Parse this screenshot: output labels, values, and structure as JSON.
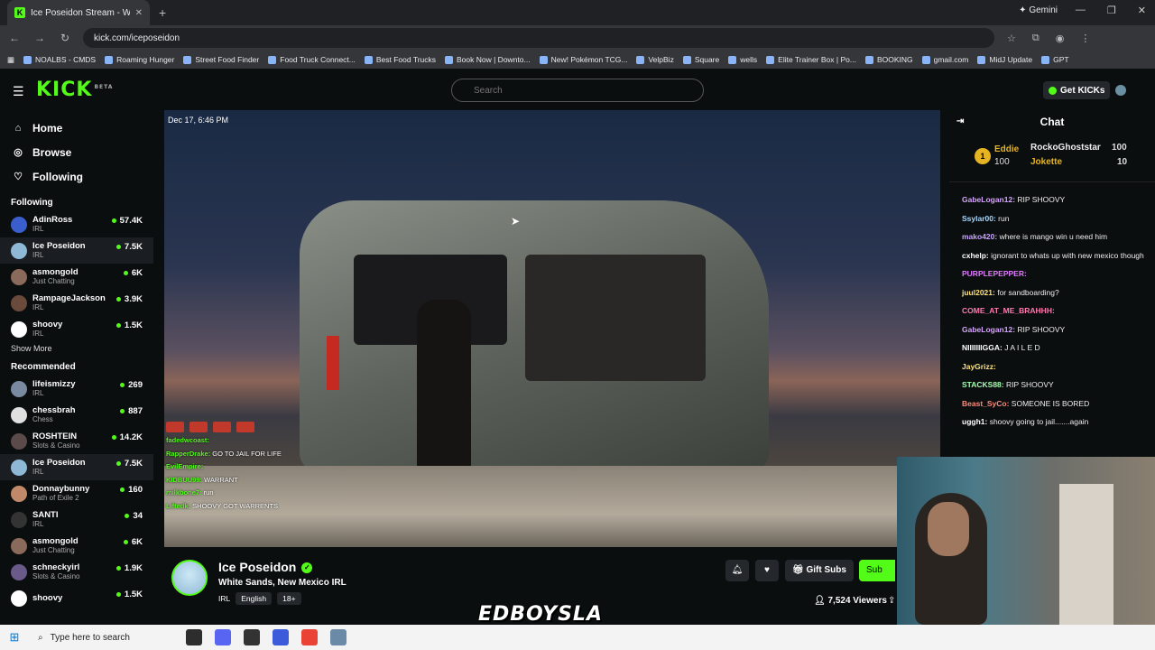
{
  "browser": {
    "tab_title": "Ice Poseidon Stream - Wat",
    "tab_favicon": "K",
    "gemini_label": "Gemini",
    "url": "kick.com/iceposeidon",
    "bookmarks": [
      "NOALBS - CMDS",
      "Roaming Hunger",
      "Street Food Finder",
      "Food Truck Connect...",
      "Best Food Trucks",
      "Book Now | Downto...",
      "New! Pokémon TCG...",
      "VelpBiz",
      "Square",
      "wells",
      "Elite Trainer Box | Po...",
      "BOOKING",
      "gmail.com",
      "MidJ Update",
      "GPT"
    ]
  },
  "header": {
    "logo": "KICK",
    "logo_badge": "BETA",
    "search_placeholder": "Search",
    "get_kicks": "Get KICKs"
  },
  "sidebar": {
    "nav": [
      {
        "label": "Home",
        "icon": "home-icon"
      },
      {
        "label": "Browse",
        "icon": "compass-icon"
      },
      {
        "label": "Following",
        "icon": "heart-icon"
      }
    ],
    "following_title": "Following",
    "following": [
      {
        "name": "AdinRoss",
        "category": "IRL",
        "viewers": "57.4K",
        "color": "#3a5fcd"
      },
      {
        "name": "Ice Poseidon",
        "category": "IRL",
        "viewers": "7.5K",
        "color": "#8fb8d6"
      },
      {
        "name": "asmongold",
        "category": "Just Chatting",
        "viewers": "6K",
        "color": "#8a6a5a"
      },
      {
        "name": "RampageJackson",
        "category": "IRL",
        "viewers": "3.9K",
        "color": "#6a4a3a"
      },
      {
        "name": "shoovy",
        "category": "IRL",
        "viewers": "1.5K",
        "color": "#ffffff"
      }
    ],
    "show_more": "Show More",
    "recommended_title": "Recommended",
    "recommended": [
      {
        "name": "lifeismizzy",
        "category": "IRL",
        "viewers": "269",
        "color": "#7a8aa0"
      },
      {
        "name": "chessbrah",
        "category": "Chess",
        "viewers": "887",
        "color": "#e0e0e0"
      },
      {
        "name": "ROSHTEIN",
        "category": "Slots & Casino",
        "viewers": "14.2K",
        "color": "#5a4a4a"
      },
      {
        "name": "Ice Poseidon",
        "category": "IRL",
        "viewers": "7.5K",
        "color": "#8fb8d6"
      },
      {
        "name": "Donnaybunny",
        "category": "Path of Exile 2",
        "viewers": "160",
        "color": "#c08a6a"
      },
      {
        "name": "SANTI",
        "category": "IRL",
        "viewers": "34",
        "color": "#333333"
      },
      {
        "name": "asmongold",
        "category": "Just Chatting",
        "viewers": "6K",
        "color": "#8a6a5a"
      },
      {
        "name": "schneckyirl",
        "category": "Slots & Casino",
        "viewers": "1.9K",
        "color": "#6a5a8a"
      },
      {
        "name": "shoovy",
        "category": "",
        "viewers": "1.5K",
        "color": "#ffffff"
      }
    ]
  },
  "video": {
    "timestamp": "Dec 17, 6:46 PM",
    "overlay_chat": [
      {
        "user": "fadedwcoast:",
        "text": ""
      },
      {
        "user": "RapperDrake:",
        "text": "GO TO JAIL FOR LIFE"
      },
      {
        "user": "EvilEmpire:",
        "text": ""
      },
      {
        "user": "KIDBUU99:",
        "text": "WARRANT"
      },
      {
        "user": "milkbone7:",
        "text": "run"
      },
      {
        "user": "Liftedk:",
        "text": "SHOOVY GOT WARRENTS"
      }
    ]
  },
  "stream": {
    "channel": "Ice Poseidon",
    "title": "White Sands, New Mexico IRL",
    "category": "IRL",
    "language": "English",
    "age": "18+",
    "gift_subs": "Gift Subs",
    "subscribe": "Sub",
    "viewers": "7,524 Viewers"
  },
  "watermark": "EDBOYSLA",
  "chat": {
    "title": "Chat",
    "pinned": {
      "rank": "1",
      "first_user": "Eddie",
      "first_amount": "100",
      "second_user": "RockoGhoststar",
      "second_amount": "100",
      "third_user": "Jokette",
      "third_amount": "10"
    },
    "messages": [
      {
        "user": "GabeLogan12:",
        "text": "RIP SHOOVY",
        "color": "#d7a5ff"
      },
      {
        "user": "Ssylar00:",
        "text": "run",
        "color": "#a5d8ff"
      },
      {
        "user": "mako420:",
        "text": "where is mango win u need him",
        "color": "#c8a5ff"
      },
      {
        "user": "cxhelp:",
        "text": "ignorant to whats up with new mexico though",
        "color": "#ffffff"
      },
      {
        "user": "PURPLEPEPPER:",
        "text": "",
        "color": "#e07aff"
      },
      {
        "user": "juul2021:",
        "text": "for sandboarding?",
        "color": "#ffe37a"
      },
      {
        "user": "COME_AT_ME_BRAHHH:",
        "text": "",
        "color": "#ff7ab0"
      },
      {
        "user": "GabeLogan12:",
        "text": "RIP SHOOVY",
        "color": "#d7a5ff"
      },
      {
        "user": "NIIIIIIIGGA:",
        "text": "J A I L E D",
        "color": "#ffffff"
      },
      {
        "user": "JayGrizz:",
        "text": "",
        "color": "#ffe37a"
      },
      {
        "user": "STACKS88:",
        "text": "RIP SHOOVY",
        "color": "#a5ffb0"
      },
      {
        "user": "Beast_SyCo:",
        "text": "SOMEONE IS BORED",
        "color": "#ff8a7a"
      },
      {
        "user": "uggh1:",
        "text": "shoovy going to jail.......again",
        "color": "#ffffff"
      }
    ]
  },
  "taskbar": {
    "search_placeholder": "Type here to search"
  }
}
